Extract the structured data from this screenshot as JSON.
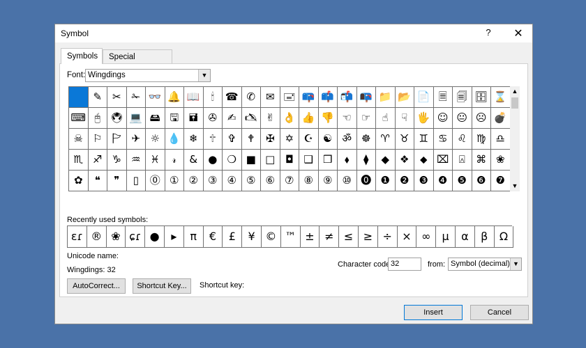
{
  "window": {
    "title": "Symbol",
    "help": "?",
    "close": "✕"
  },
  "tabs": [
    {
      "label": "Symbols",
      "active": true
    },
    {
      "label": "Special Characters",
      "active": false
    }
  ],
  "font": {
    "label": "Font:",
    "value": "Wingdings"
  },
  "grid": {
    "rows": [
      [
        "",
        "✎",
        "✂",
        "✁",
        "👓",
        "🔔",
        "📖",
        "🕯",
        "☎",
        "✆",
        "✉",
        "🖃",
        "📪",
        "📫",
        "📬",
        "📭",
        "📁",
        "📂",
        "📄",
        "🗏",
        "🗐",
        "🗄",
        "⌛"
      ],
      [
        "⌨",
        "🖰",
        "🖲",
        "💻",
        "🖴",
        "🖫",
        "🖬",
        "✇",
        "✍",
        "🖎",
        "✌",
        "👌",
        "👍",
        "👎",
        "☜",
        "☞",
        "☝",
        "☟",
        "🖐",
        "☺",
        "😐",
        "☹",
        "💣"
      ],
      [
        "☠",
        "⚐",
        "🏱",
        "✈",
        "☼",
        "💧",
        "❄",
        "🕆",
        "✞",
        "🕈",
        "✠",
        "✡",
        "☪",
        "☯",
        "ॐ",
        "☸",
        "♈",
        "♉",
        "♊",
        "♋",
        "♌",
        "♍",
        "♎"
      ],
      [
        "♏",
        "♐",
        "♑",
        "♒",
        "♓",
        "𝓇",
        "&",
        "●",
        "❍",
        "■",
        "□",
        "◘",
        "❑",
        "❒",
        "⬧",
        "⧫",
        "◆",
        "❖",
        "⬥",
        "⌧",
        "⍓",
        "⌘",
        "❀"
      ],
      [
        "✿",
        "❝",
        "❞",
        "▯",
        "⓪",
        "①",
        "②",
        "③",
        "④",
        "⑤",
        "⑥",
        "⑦",
        "⑧",
        "⑨",
        "⑩",
        "⓿",
        "❶",
        "❷",
        "❸",
        "❹",
        "❺",
        "❻",
        "❼"
      ]
    ]
  },
  "recent": {
    "label": "Recently used symbols:",
    "symbols": [
      "ɛɾ",
      "®",
      "❀",
      "ɕɾ",
      "●",
      "▸",
      "π",
      "€",
      "£",
      "¥",
      "©",
      "™",
      "±",
      "≠",
      "≤",
      "≥",
      "÷",
      "×",
      "∞",
      "µ",
      "α",
      "β",
      "Ω"
    ]
  },
  "unicode": {
    "label": "Unicode name:",
    "value": "Wingdings: 32"
  },
  "character_code": {
    "label": "Character code:",
    "value": "32"
  },
  "from": {
    "label": "from:",
    "value": "Symbol (decimal)"
  },
  "buttons": {
    "autocorrect": "AutoCorrect...",
    "shortcut_key": "Shortcut Key...",
    "insert": "Insert",
    "cancel": "Cancel"
  },
  "shortcut_key_label": "Shortcut key:",
  "colors": {
    "desktop": "#4a72a8",
    "selection": "#0a78d7",
    "accent_border": "#0078d7"
  }
}
